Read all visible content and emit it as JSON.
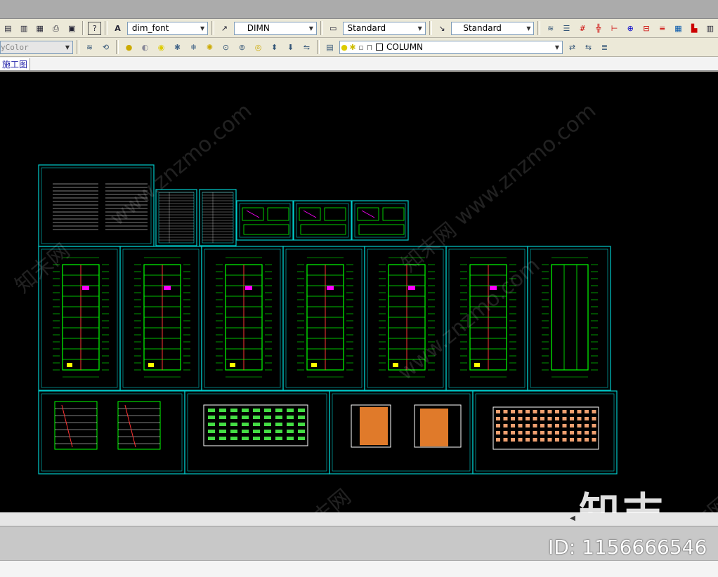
{
  "toolbar1": {
    "text_style": "dim_font",
    "dim_style": "DIMN",
    "table_style": "Standard",
    "mleader_style": "Standard"
  },
  "toolbar2": {
    "color_combo": "yColor",
    "layer_combo": "COLUMN"
  },
  "tab": {
    "label": "施工图"
  },
  "watermark": {
    "text": "www.znzmo.com",
    "brand_cn": "知末网",
    "logo": "知末",
    "image_id": "ID: 1156666546"
  },
  "colors": {
    "canvas": "#000000",
    "frame": "#00cccc",
    "line": "#00ff00",
    "accent": "#ff00ff",
    "wall": "#ff3333",
    "facade": "#e07a2a"
  }
}
